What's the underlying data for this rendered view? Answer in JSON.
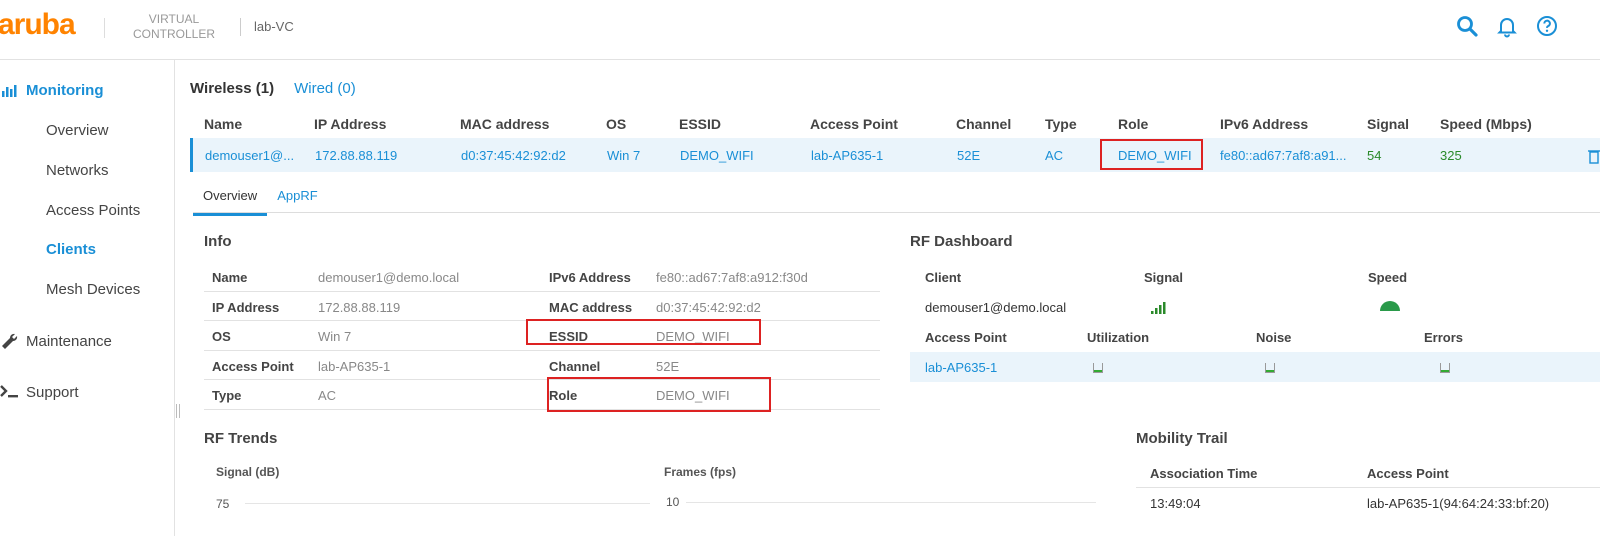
{
  "header": {
    "logo": "aruba",
    "product_line1": "VIRTUAL",
    "product_line2": "CONTROLLER",
    "vc_name": "lab-VC",
    "icons": [
      "search-icon",
      "bell-icon",
      "help-icon"
    ],
    "accent": "#1a8fd6"
  },
  "sidebar": {
    "monitoring": "Monitoring",
    "items": [
      "Overview",
      "Networks",
      "Access Points",
      "Clients",
      "Mesh Devices"
    ],
    "active_item": "Clients",
    "maintenance": "Maintenance",
    "support": "Support"
  },
  "client_tabs": {
    "wireless": "Wireless (1)",
    "wired": "Wired (0)"
  },
  "client_table": {
    "columns": [
      "Name",
      "IP Address",
      "MAC address",
      "OS",
      "ESSID",
      "Access Point",
      "Channel",
      "Type",
      "Role",
      "IPv6 Address",
      "Signal",
      "Speed (Mbps)"
    ],
    "row": {
      "name": "demouser1@...",
      "ip": "172.88.88.119",
      "mac": "d0:37:45:42:92:d2",
      "os": "Win 7",
      "essid": "DEMO_WIFI",
      "ap": "lab-AP635-1",
      "channel": "52E",
      "type": "AC",
      "role": "DEMO_WIFI",
      "ipv6": "fe80::ad67:7af8:a91...",
      "signal": "54",
      "speed": "325"
    }
  },
  "detail_tabs": {
    "overview": "Overview",
    "apprf": "AppRF"
  },
  "info": {
    "title": "Info",
    "left": [
      {
        "label": "Name",
        "value": "demouser1@demo.local"
      },
      {
        "label": "IP Address",
        "value": "172.88.88.119"
      },
      {
        "label": "OS",
        "value": "Win 7"
      },
      {
        "label": "Access Point",
        "value": "lab-AP635-1"
      },
      {
        "label": "Type",
        "value": "AC"
      }
    ],
    "right": [
      {
        "label": "IPv6 Address",
        "value": "fe80::ad67:7af8:a912:f30d"
      },
      {
        "label": "MAC address",
        "value": "d0:37:45:42:92:d2"
      },
      {
        "label": "ESSID",
        "value": "DEMO_WIFI"
      },
      {
        "label": "Channel",
        "value": "52E"
      },
      {
        "label": "Role",
        "value": "DEMO_WIFI"
      }
    ]
  },
  "rf_dashboard": {
    "title": "RF Dashboard",
    "client_headers": [
      "Client",
      "Signal",
      "Speed"
    ],
    "client_name": "demouser1@demo.local",
    "ap_headers": [
      "Access Point",
      "Utilization",
      "Noise",
      "Errors"
    ],
    "ap_name": "lab-AP635-1"
  },
  "rf_trends": {
    "title": "RF Trends",
    "signal_label": "Signal (dB)",
    "signal_tick": "75",
    "frames_label": "Frames (fps)",
    "frames_tick": "10"
  },
  "mobility": {
    "title": "Mobility Trail",
    "headers": [
      "Association Time",
      "Access Point"
    ],
    "row": {
      "time": "13:49:04",
      "ap": "lab-AP635-1(94:64:24:33:bf:20)"
    }
  }
}
